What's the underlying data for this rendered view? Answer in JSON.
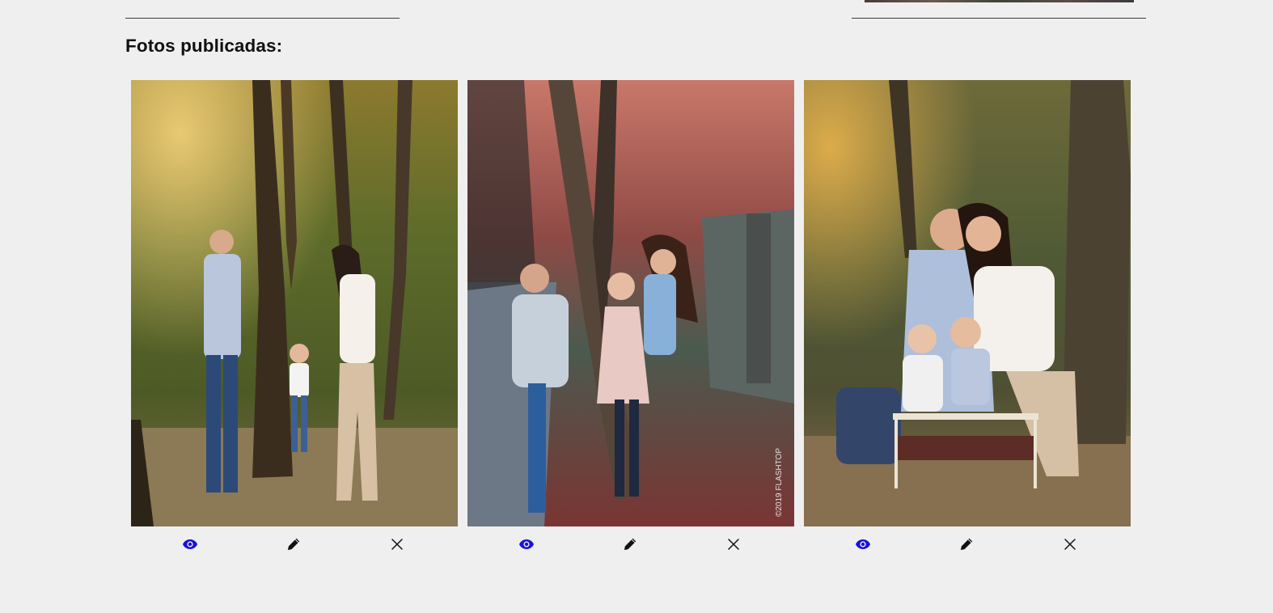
{
  "section": {
    "title": "Fotos publicadas:"
  },
  "photos": [
    {
      "scene": "family-walking-in-forest",
      "actions": [
        "view",
        "edit",
        "delete"
      ]
    },
    {
      "scene": "family-behind-red-leaf-tree",
      "watermark": "©2019 FLASHTOP",
      "actions": [
        "view",
        "edit",
        "delete"
      ]
    },
    {
      "scene": "family-posing-with-children-on-bench",
      "actions": [
        "view",
        "edit",
        "delete"
      ]
    }
  ],
  "icons": {
    "view": "eye-icon",
    "edit": "pencil-icon",
    "delete": "close-icon"
  },
  "colors": {
    "background": "#efefef",
    "view_icon": "#1a12d8",
    "edit_icon": "#111111",
    "delete_icon": "#111111"
  }
}
